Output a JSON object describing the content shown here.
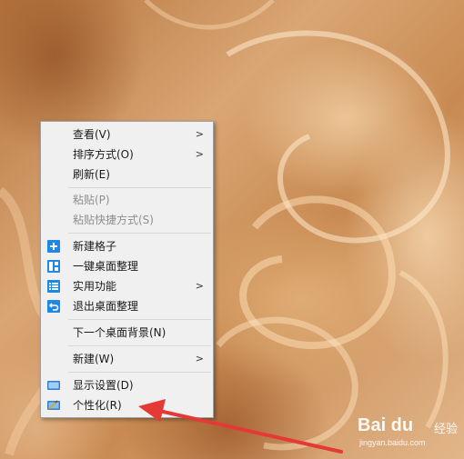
{
  "menu": {
    "items": [
      {
        "label": "查看(V)",
        "submenu": true
      },
      {
        "label": "排序方式(O)",
        "submenu": true
      },
      {
        "label": "刷新(E)"
      },
      {
        "label": "粘贴(P)",
        "disabled": true
      },
      {
        "label": "粘贴快捷方式(S)",
        "disabled": true
      },
      {
        "label": "新建格子",
        "icon": "plus-box-icon"
      },
      {
        "label": "一键桌面整理",
        "icon": "grid-layout-icon"
      },
      {
        "label": "实用功能",
        "icon": "list-icon",
        "submenu": true
      },
      {
        "label": "退出桌面整理",
        "icon": "exit-arrow-icon"
      },
      {
        "label": "下一个桌面背景(N)"
      },
      {
        "label": "新建(W)",
        "submenu": true
      },
      {
        "label": "显示设置(D)",
        "icon": "display-monitor-icon"
      },
      {
        "label": "个性化(R)",
        "icon": "personalize-icon"
      }
    ],
    "submenu_arrow": ">"
  },
  "watermark": {
    "logo": "Bai du",
    "text": "经验",
    "url": "jingyan.baidu.com"
  },
  "colors": {
    "menu_bg": "#f0f0f0",
    "accent_blue": "#1e88e5",
    "annotation_red": "#e53935"
  }
}
